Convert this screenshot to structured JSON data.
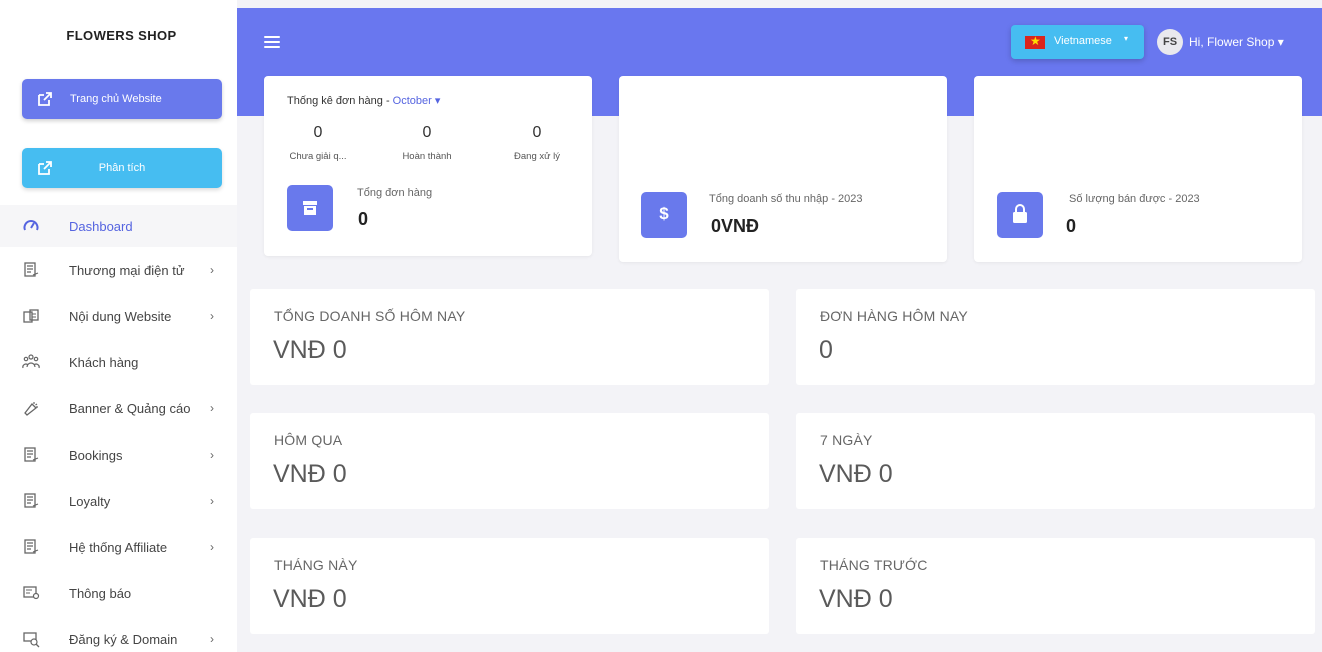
{
  "sidebar": {
    "brand": "FLOWERS SHOP",
    "home_button": "Trang chủ Website",
    "analytics_button": "Phân tích",
    "items": [
      {
        "label": "Dashboard",
        "icon": "dashboard-gauge-icon",
        "active": true
      },
      {
        "label": "Thương mại điện tử",
        "icon": "document-edit-icon",
        "chevron": "›"
      },
      {
        "label": "Nội dung Website",
        "icon": "content-boxes-icon",
        "chevron": "›"
      },
      {
        "label": "Khách hàng",
        "icon": "users-group-icon"
      },
      {
        "label": "Banner & Quảng cáo",
        "icon": "megaphone-icon",
        "chevron": "›"
      },
      {
        "label": "Bookings",
        "icon": "document-edit-icon",
        "chevron": "›"
      },
      {
        "label": "Loyalty",
        "icon": "document-edit-icon",
        "chevron": "›"
      },
      {
        "label": "Hệ thống Affiliate",
        "icon": "document-edit-icon",
        "chevron": "›"
      },
      {
        "label": "Thông báo",
        "icon": "notification-icon"
      },
      {
        "label": "Đăng ký & Domain",
        "icon": "domain-search-icon",
        "chevron": "›"
      }
    ]
  },
  "header": {
    "language": "Vietnamese",
    "language_caret": "▾",
    "flag_star": "★",
    "avatar_initials": "FS",
    "greeting": "Hi, Flower Shop ▾"
  },
  "orders": {
    "title": "Thống kê đơn hàng - ",
    "month": "October ▾",
    "stats": [
      {
        "value": "0",
        "label": "Chưa giải q..."
      },
      {
        "value": "0",
        "label": "Hoàn thành"
      },
      {
        "value": "0",
        "label": "Đang xử lý"
      }
    ],
    "total_label": "Tổng đơn hàng",
    "total_value": "0"
  },
  "revenue": {
    "label": "Tổng doanh số thu nhập - 2023",
    "value": "0VNĐ",
    "icon_glyph": "$"
  },
  "quantity": {
    "label": "Số lượng bán được - 2023",
    "value": "0"
  },
  "panels": [
    {
      "title": "TỔNG DOANH SỐ HÔM NAY",
      "value": "VNĐ 0"
    },
    {
      "title": "ĐƠN HÀNG HÔM NAY",
      "value": "0"
    },
    {
      "title": "HÔM QUA",
      "value": "VNĐ 0"
    },
    {
      "title": "7 NGÀY",
      "value": "VNĐ 0"
    },
    {
      "title": "THÁNG NÀY",
      "value": "VNĐ 0"
    },
    {
      "title": "THÁNG TRƯỚC",
      "value": "VNĐ 0"
    }
  ],
  "colors": {
    "primary": "#6977ef",
    "info": "#46bdf1",
    "active_text": "#5564e0"
  }
}
